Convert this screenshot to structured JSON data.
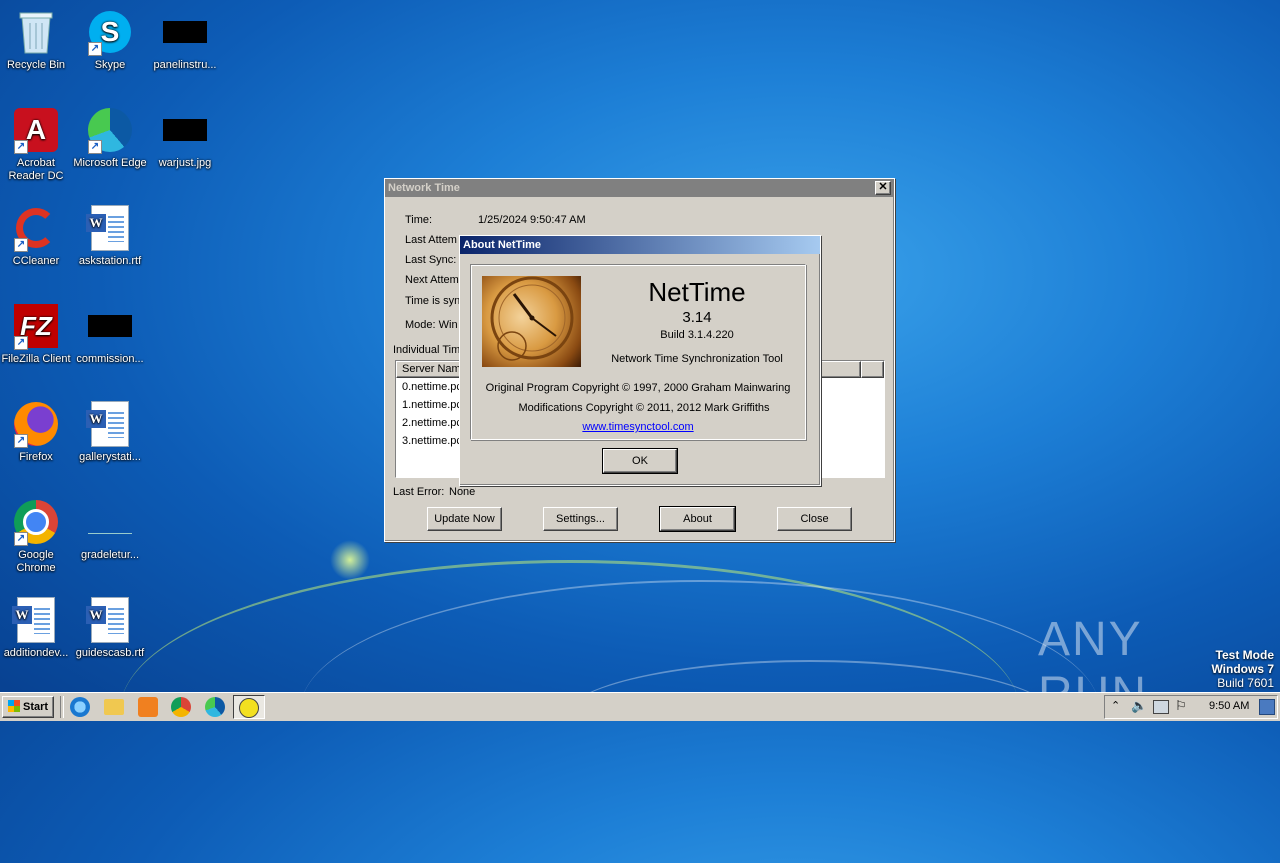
{
  "desktop": {
    "icons": [
      {
        "label": "Recycle Bin"
      },
      {
        "label": "Skype"
      },
      {
        "label": "panelinstru..."
      },
      {
        "label": "Acrobat Reader DC"
      },
      {
        "label": "Microsoft Edge"
      },
      {
        "label": "warjust.jpg"
      },
      {
        "label": "CCleaner"
      },
      {
        "label": "askstation.rtf"
      },
      {
        "label": "FileZilla Client"
      },
      {
        "label": "commission..."
      },
      {
        "label": "Firefox"
      },
      {
        "label": "gallerystati..."
      },
      {
        "label": "Google Chrome"
      },
      {
        "label": "gradeletur..."
      },
      {
        "label": "additiondev..."
      },
      {
        "label": "guidescasb.rtf"
      }
    ],
    "watermark": {
      "text": "ANY RUN"
    },
    "test_mode": {
      "line1": "Test Mode",
      "line2": "Windows 7",
      "line3": "Build 7601"
    }
  },
  "nettime_window": {
    "title": "Network Time",
    "time_label": "Time:",
    "time_value": "1/25/2024 9:50:47 AM",
    "last_attempt_label": "Last Attem",
    "last_sync_label": "Last Sync:",
    "next_attempt_label": "Next Attem",
    "time_is_label": "Time is syn",
    "mode_label": "Mode: Win",
    "individual_label": "Individual Tim",
    "server_column": "Server Nam",
    "servers": [
      "0.nettime.pc",
      "1.nettime.pc",
      "2.nettime.pc",
      "3.nettime.pc"
    ],
    "last_error_label": "Last Error:",
    "last_error_value": "None",
    "buttons": {
      "update_now": "Update Now",
      "settings": "Settings...",
      "about": "About",
      "close": "Close"
    }
  },
  "about_dialog": {
    "title": "About NetTime",
    "app_name": "NetTime",
    "version": "3.14",
    "build": "Build 3.1.4.220",
    "tagline": "Network Time Synchronization Tool",
    "copyright_original": "Original Program Copyright © 1997, 2000 Graham Mainwaring",
    "copyright_mods": "Modifications Copyright © 2011, 2012 Mark Griffiths",
    "link": "www.timesynctool.com",
    "ok_label": "OK"
  },
  "taskbar": {
    "start_label": "Start",
    "clock": "9:50 AM"
  },
  "colors": {
    "title_active_start": "#0a246a",
    "title_active_end": "#a6caf0",
    "title_inactive": "#808080",
    "link": "#0000ff"
  }
}
